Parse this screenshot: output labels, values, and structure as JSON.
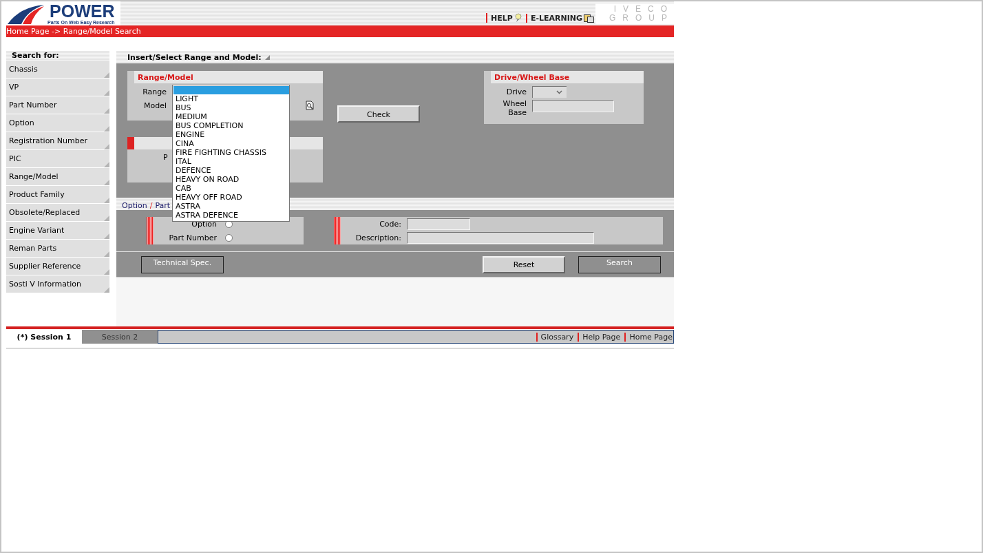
{
  "header": {
    "logo": {
      "title": "POWER",
      "subtitle": "Parts On Web Easy Research"
    },
    "links": [
      {
        "label": "HELP",
        "kind": "help"
      },
      {
        "label": "E-LEARNING",
        "kind": "elearning"
      }
    ],
    "brand": {
      "top": "IVECO",
      "bottom": "GROUP"
    }
  },
  "breadcrumb": "Home Page -> Range/Model Search",
  "sidebar": {
    "title": "Search for:",
    "items": [
      {
        "label": "Chassis"
      },
      {
        "label": "VP"
      },
      {
        "label": "Part Number"
      },
      {
        "label": "Option"
      },
      {
        "label": "Registration Number"
      },
      {
        "label": "PIC"
      },
      {
        "label": "Range/Model"
      },
      {
        "label": "Product Family"
      },
      {
        "label": "Obsolete/Replaced"
      },
      {
        "label": "Engine Variant"
      },
      {
        "label": "Reman Parts"
      },
      {
        "label": "Supplier Reference"
      },
      {
        "label": "Sosti V Information"
      }
    ]
  },
  "main": {
    "title": "Insert/Select Range and Model:",
    "range_model": {
      "title": "Range/Model",
      "range_label": "Range",
      "model_label": "Model"
    },
    "second_panel": {
      "label": "P"
    },
    "check_button": "Check",
    "drive_panel": {
      "title": "Drive/Wheel Base",
      "drive_label": "Drive",
      "wheel_base_label": "Wheel Base"
    },
    "range_dropdown": {
      "blank_highlighted": true,
      "options": [
        {
          "label": "LIGHT"
        },
        {
          "label": "BUS"
        },
        {
          "label": "MEDIUM"
        },
        {
          "label": "BUS COMPLETION"
        },
        {
          "label": "ENGINE"
        },
        {
          "label": "CINA"
        },
        {
          "label": "FIRE FIGHTING CHASSIS"
        },
        {
          "label": "ITAL"
        },
        {
          "label": "DEFENCE"
        },
        {
          "label": "HEAVY ON ROAD"
        },
        {
          "label": "CAB"
        },
        {
          "label": "HEAVY OFF ROAD"
        },
        {
          "label": "ASTRA"
        },
        {
          "label": "ASTRA DEFENCE"
        }
      ]
    }
  },
  "option_part": {
    "tabs": [
      {
        "label": "Option"
      },
      {
        "label": "Part"
      }
    ],
    "separator": "/",
    "search_by": [
      {
        "label": "Option",
        "selected": false
      },
      {
        "label": "Part Number",
        "selected": false
      }
    ],
    "code_label": "Code:",
    "description_label": "Description:"
  },
  "buttons": [
    {
      "label": "Technical Spec.",
      "kind": "dark"
    },
    {
      "label": "Reset",
      "kind": "light"
    },
    {
      "label": "Search",
      "kind": "dark"
    }
  ],
  "footer": {
    "sessions": [
      {
        "label": "(*) Session 1",
        "selected": true
      },
      {
        "label": "Session 2",
        "selected": false
      }
    ],
    "links": [
      {
        "label": "Glossary"
      },
      {
        "label": "Help Page"
      },
      {
        "label": "Home Page"
      }
    ]
  }
}
